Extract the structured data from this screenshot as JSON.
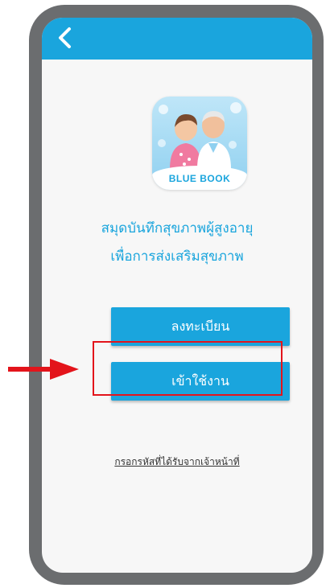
{
  "header": {
    "back_icon": "chevron-left-icon"
  },
  "logo": {
    "label": "BLUE BOOK",
    "icon": "elderly-couple-illustration"
  },
  "title": {
    "line1": "สมุดบันทึกสุขภาพผู้สูงอายุ",
    "line2": "เพื่อการส่งเสริมสุขภาพ"
  },
  "buttons": {
    "register": "ลงทะเบียน",
    "login": "เข้าใช้งาน"
  },
  "link": {
    "code_entry": "กรอกรหัสที่ได้รับจากเจ้าหน้าที่"
  },
  "annotation": {
    "arrow_icon": "red-arrow-right-icon",
    "highlight_color": "#e3141b"
  },
  "colors": {
    "accent": "#1aa5dd",
    "annotation": "#e3141b"
  }
}
